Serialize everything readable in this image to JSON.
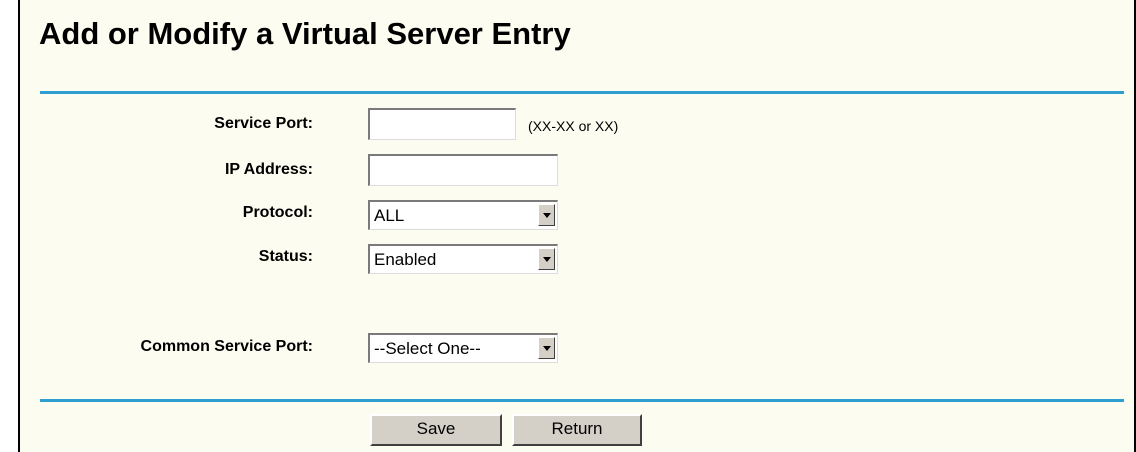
{
  "page": {
    "title": "Add or Modify a Virtual Server Entry"
  },
  "form": {
    "service_port": {
      "label": "Service Port:",
      "value": "",
      "hint": "(XX-XX or XX)"
    },
    "ip_address": {
      "label": "IP Address:",
      "value": ""
    },
    "protocol": {
      "label": "Protocol:",
      "selected": "ALL"
    },
    "status": {
      "label": "Status:",
      "selected": "Enabled"
    },
    "common_service_port": {
      "label": "Common Service Port:",
      "selected": "--Select One--"
    }
  },
  "buttons": {
    "save": "Save",
    "return": "Return"
  },
  "colors": {
    "page_background": "#fcfcf0",
    "rule": "#2f9fd2",
    "button_face": "#d4d0c8"
  },
  "icons": {
    "dropdown_arrow": "chevron-down-icon"
  }
}
